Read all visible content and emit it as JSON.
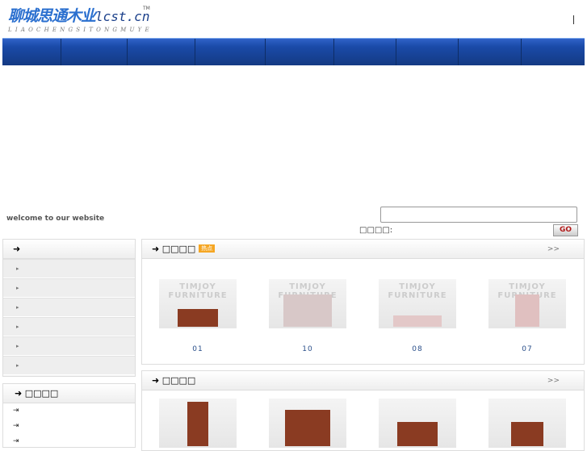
{
  "logo": {
    "name_cn": "聊城思通木业",
    "domain": "lcst.cn",
    "tm": "TM",
    "pinyin": "LIAOCHENGSITONGMUYE"
  },
  "welcome": "welcome to our website",
  "search": {
    "label": "□□□□:",
    "value": "",
    "go": "GO"
  },
  "sidebar": {
    "items": [
      "",
      "",
      "",
      "",
      "",
      ""
    ],
    "box2_title": "□□□□",
    "links": [
      "",
      "",
      ""
    ]
  },
  "panel1": {
    "title": "□□□□",
    "badge": "热点",
    "more": ">>",
    "products": [
      {
        "label": "01"
      },
      {
        "label": "10"
      },
      {
        "label": "08"
      },
      {
        "label": "07"
      }
    ]
  },
  "panel2": {
    "title": "□□□□",
    "more": ">>",
    "brand": "TIMJOY FURNITURE"
  }
}
